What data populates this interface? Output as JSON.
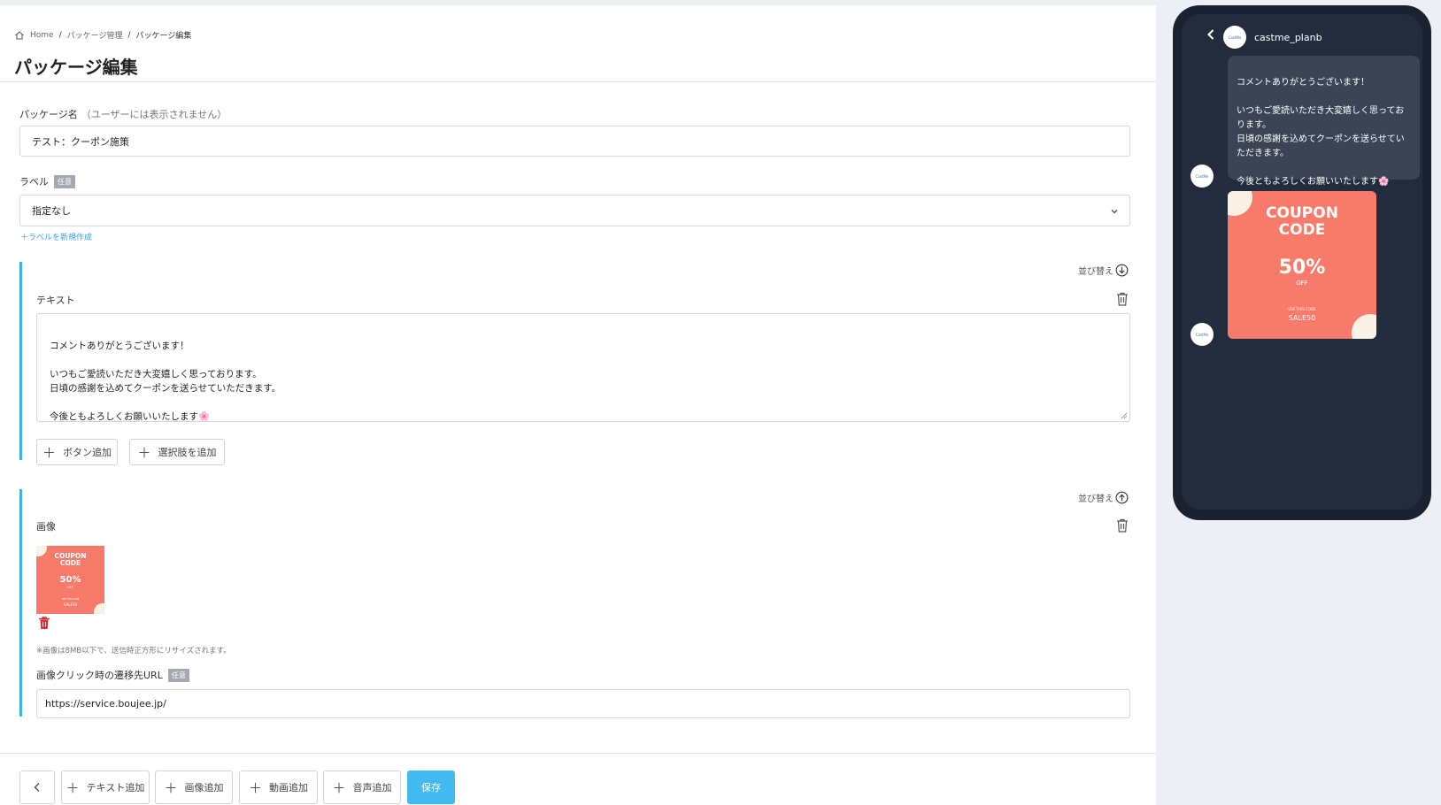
{
  "breadcrumb": {
    "home": "Home",
    "sep": "/",
    "level2": "パッケージ管理",
    "current": "パッケージ編集"
  },
  "page_title": "パッケージ編集",
  "package_name": {
    "label": "パッケージ名",
    "hint": "（ユーザーには表示されません）",
    "value": "テスト：クーポン施策"
  },
  "label_field": {
    "label": "ラベル",
    "badge": "任意",
    "value": "指定なし",
    "create_link": "＋ラベルを新規作成"
  },
  "text_block": {
    "sort_label": "並び替え",
    "title": "テキスト",
    "content": "コメントありがとうございます！\n\nいつもご愛読いただき大変嬉しく思っております。\n日頃の感謝を込めてクーポンを送らせていただきます。\n\n今後ともよろしくお願いいたします🌸",
    "add_button": "ボタン追加",
    "add_choice": "選択肢を追加"
  },
  "image_block": {
    "sort_label": "並び替え",
    "title": "画像",
    "coupon": {
      "line1": "COUPON",
      "line2": "CODE",
      "percent": "50%",
      "off": "OFF",
      "use": "USE THIS CODE",
      "code": "SALE50"
    },
    "note": "※画像は8MB以下で、送信時正方形にリサイズされます。",
    "url_label": "画像クリック時の遷移先URL",
    "url_badge": "任意",
    "url_value": "https://service.boujee.jp/"
  },
  "footer": {
    "back_icon": "chevron-left-icon",
    "add_text": "テキスト追加",
    "add_image": "画像追加",
    "add_video": "動画追加",
    "add_audio": "音声追加",
    "save": "保存"
  },
  "preview": {
    "account_name": "castme_planb",
    "avatar_text": "CastMe",
    "message": "コメントありがとうございます！\n\nいつもご愛読いただき大変嬉しく思っております。\n日頃の感謝を込めてクーポンを送らせていただきます。\n\n今後ともよろしくお願いいたします🌸"
  },
  "colors": {
    "accent": "#42b9ef",
    "coupon": "#f77a6a",
    "phone_bg": "#232c3d",
    "bubble": "#3b4455",
    "danger": "#d9303b"
  }
}
